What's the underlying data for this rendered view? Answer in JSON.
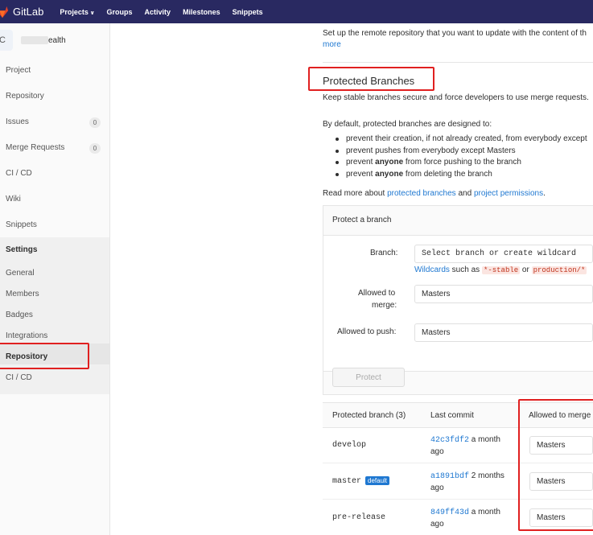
{
  "topbar": {
    "brand": "GitLab",
    "nav": [
      "Projects",
      "Groups",
      "Activity",
      "Milestones",
      "Snippets"
    ]
  },
  "sidebar": {
    "avatar_letter": "C",
    "project_name_suffix": "ealth",
    "items": [
      {
        "label": "Project"
      },
      {
        "label": "Repository"
      },
      {
        "label": "Issues",
        "count": "0"
      },
      {
        "label": "Merge Requests",
        "count": "0"
      },
      {
        "label": "CI / CD"
      },
      {
        "label": "Wiki"
      },
      {
        "label": "Snippets"
      }
    ],
    "settings": {
      "label": "Settings",
      "subitems": [
        "General",
        "Members",
        "Badges",
        "Integrations",
        "Repository",
        "CI / CD"
      ]
    }
  },
  "mirror": {
    "text": "Set up the remote repository that you want to update with the content of th",
    "more_link": "more"
  },
  "protected": {
    "title": "Protected Branches",
    "subtitle": "Keep stable branches secure and force developers to use merge requests.",
    "intro": "By default, protected branches are designed to:",
    "bullets": [
      {
        "pre": "prevent their creation, if not already created, from everybody except",
        "bold": "",
        "post": ""
      },
      {
        "pre": "prevent pushes from everybody except Masters",
        "bold": "",
        "post": ""
      },
      {
        "pre": "prevent ",
        "bold": "anyone",
        "post": " from force pushing to the branch"
      },
      {
        "pre": "prevent ",
        "bold": "anyone",
        "post": " from deleting the branch"
      }
    ],
    "read_more": {
      "prefix": "Read more about ",
      "link1": "protected branches",
      "mid": " and ",
      "link2": "project permissions",
      "suffix": "."
    }
  },
  "protect_form": {
    "header": "Protect a branch",
    "branch_label": "Branch:",
    "branch_placeholder": "Select branch or create wildcard",
    "wildcards_link": "Wildcards",
    "wildcards_mid1": " such as ",
    "wildcard_example1": "*-stable",
    "wildcards_mid2": " or ",
    "wildcard_example2": "production/*",
    "merge_label_line1": "Allowed to",
    "merge_label_line2": "merge:",
    "merge_value": "Masters",
    "push_label": "Allowed to push:",
    "push_value": "Masters",
    "protect_button": "Protect"
  },
  "table": {
    "headers": {
      "branch": "Protected branch (3)",
      "commit": "Last commit",
      "merge": "Allowed to merge"
    },
    "rows": [
      {
        "branch": "develop",
        "commit": "42c3fdf2",
        "time1": " a month",
        "time2": "ago",
        "badge": "",
        "merge": "Masters"
      },
      {
        "branch": "master",
        "commit": "a1891bdf",
        "time1": " 2 months",
        "time2": "ago",
        "badge": "default",
        "merge": "Masters"
      },
      {
        "branch": "pre-release",
        "commit": "849ff43d",
        "time1": " a month",
        "time2": "ago",
        "badge": "",
        "merge": "Masters"
      }
    ]
  },
  "colors": {
    "topbar": "#292961",
    "link": "#1f78d1",
    "highlight": "#e02020"
  }
}
